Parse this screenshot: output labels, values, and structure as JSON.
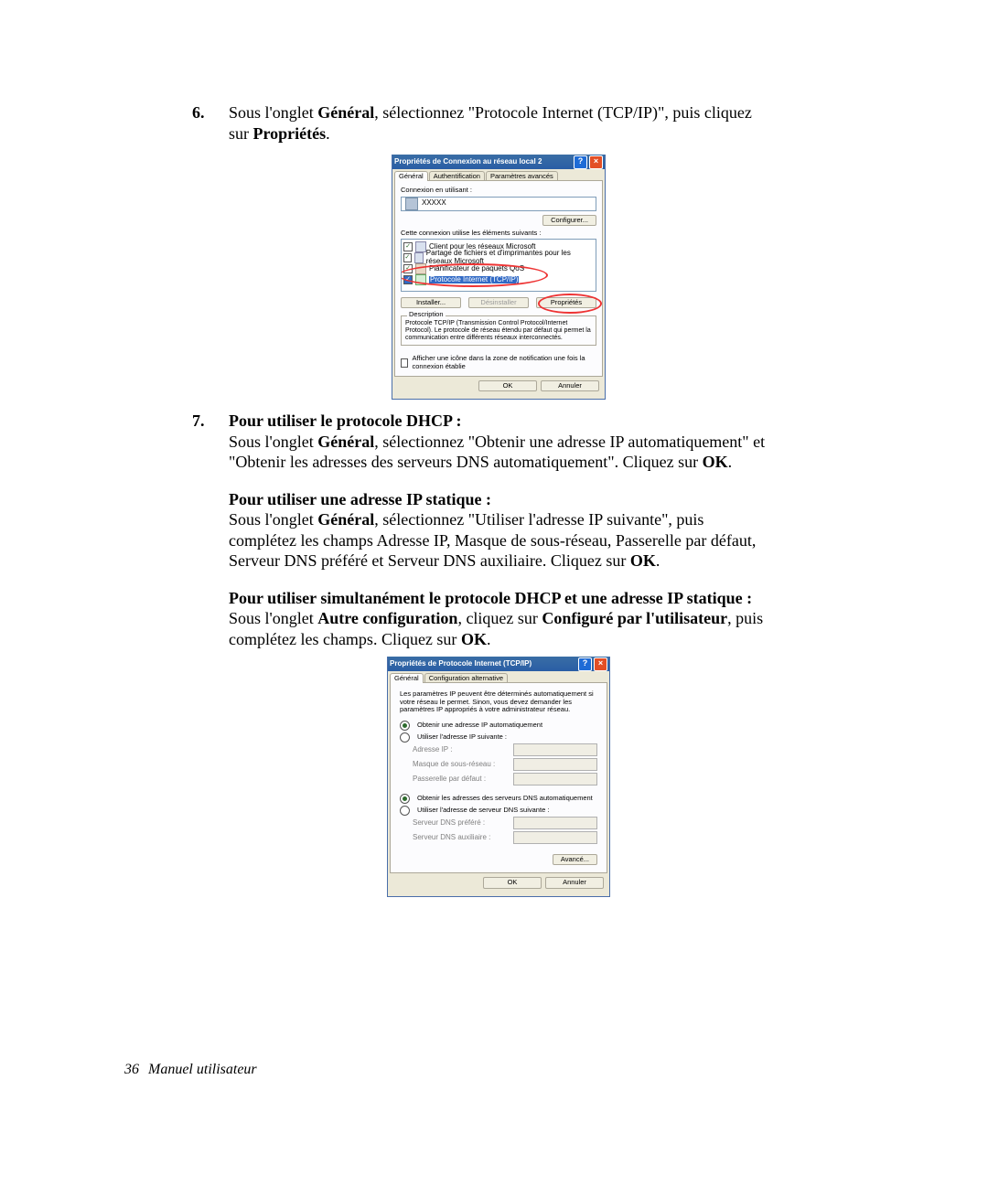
{
  "step6": {
    "num": "6.",
    "text1": "Sous l'onglet ",
    "bold1": "Général",
    "text2": ", sélectionnez \"Protocole Internet (TCP/IP)\", puis cliquez sur ",
    "bold2": "Propriétés",
    "text3": "."
  },
  "dialog1": {
    "title": "Propriétés de Connexion au réseau local 2",
    "tabs": [
      "Général",
      "Authentification",
      "Paramètres avancés"
    ],
    "connect_label": "Connexion en utilisant :",
    "adapter": "XXXXX",
    "configure_btn": "Configurer...",
    "elements_label": "Cette connexion utilise les éléments suivants :",
    "items": [
      "Client pour les réseaux Microsoft",
      "Partage de fichiers et d'imprimantes pour les réseaux Microsoft",
      "Planificateur de paquets QoS",
      "Protocole Internet (TCP/IP)"
    ],
    "install_btn": "Installer...",
    "uninstall_btn": "Désinstaller",
    "props_btn": "Propriétés",
    "desc_title": "Description",
    "desc_text": "Protocole TCP/IP (Transmission Control Protocol/Internet Protocol). Le protocole de réseau étendu par défaut qui permet la communication entre différents réseaux interconnectés.",
    "show_icon": "Afficher une icône dans la zone de notification une fois la connexion établie",
    "ok": "OK",
    "cancel": "Annuler"
  },
  "step7": {
    "num": "7.",
    "heading": "Pour utiliser le protocole DHCP :",
    "line1a": "Sous l'onglet ",
    "line1b": "Général",
    "line1c": ", sélectionnez \"Obtenir une adresse IP automatiquement\" et \"Obtenir les adresses des serveurs DNS automatiquement\". Cliquez sur ",
    "line1d": "OK",
    "line1e": "."
  },
  "static": {
    "heading": "Pour utiliser une adresse IP statique :",
    "l1a": "Sous l'onglet ",
    "l1b": "Général",
    "l1c": ", sélectionnez \"Utiliser l'adresse IP suivante\", puis complétez les champs Adresse IP, Masque de sous-réseau, Passerelle par défaut, Serveur DNS préféré et Serveur DNS auxiliaire. Cliquez sur ",
    "l1d": "OK",
    "l1e": "."
  },
  "both": {
    "heading": "Pour utiliser simultanément le protocole DHCP et une adresse IP statique :",
    "l1a": "Sous l'onglet ",
    "l1b": "Autre configuration",
    "l1c": ", cliquez sur ",
    "l1d": "Configuré par l'utilisateur",
    "l1e": ", puis complétez les champs. Cliquez sur ",
    "l1f": "OK",
    "l1g": "."
  },
  "dialog2": {
    "title": "Propriétés de Protocole Internet (TCP/IP)",
    "tabs": [
      "Général",
      "Configuration alternative"
    ],
    "intro": "Les paramètres IP peuvent être déterminés automatiquement si votre réseau le permet. Sinon, vous devez demander les paramètres IP appropriés à votre administrateur réseau.",
    "r_auto_ip": "Obtenir une adresse IP automatiquement",
    "r_use_ip": "Utiliser l'adresse IP suivante :",
    "ip_label": "Adresse IP :",
    "mask_label": "Masque de sous-réseau :",
    "gw_label": "Passerelle par défaut :",
    "r_auto_dns": "Obtenir les adresses des serveurs DNS automatiquement",
    "r_use_dns": "Utiliser l'adresse de serveur DNS suivante :",
    "dns1_label": "Serveur DNS préféré :",
    "dns2_label": "Serveur DNS auxiliaire :",
    "advanced_btn": "Avancé...",
    "ok": "OK",
    "cancel": "Annuler"
  },
  "footer": {
    "page": "36",
    "title": "Manuel utilisateur"
  }
}
